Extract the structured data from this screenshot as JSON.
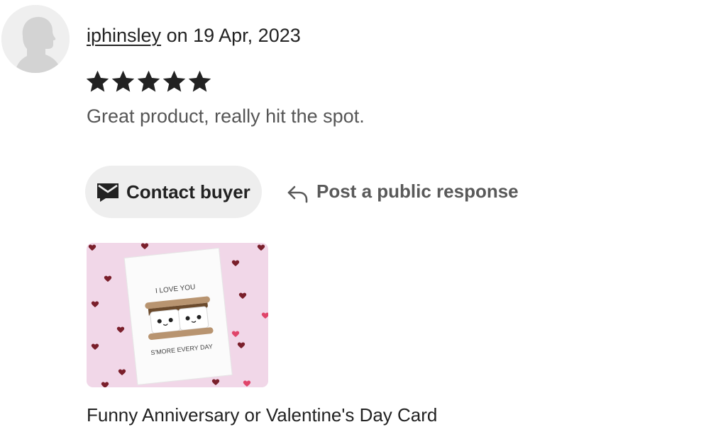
{
  "review": {
    "username": "iphinsley",
    "date_text": "on 19 Apr, 2023",
    "rating": 5,
    "rating_max": 5,
    "text": "Great product, really hit the spot."
  },
  "actions": {
    "contact_label": "Contact buyer",
    "contact_icon": "envelope-icon",
    "respond_label": "Post a public response",
    "respond_icon": "reply-arrow-icon"
  },
  "product": {
    "title": "Funny Anniversary or Valentine's Day Card",
    "card_text_top": "I LOVE YOU",
    "card_text_bottom": "S'MORE EVERY DAY"
  },
  "colors": {
    "text": "#222222",
    "muted_text": "#555555",
    "button_bg": "#eeeeee",
    "star": "#222222",
    "thumb_bg": "#f1d7e8"
  }
}
